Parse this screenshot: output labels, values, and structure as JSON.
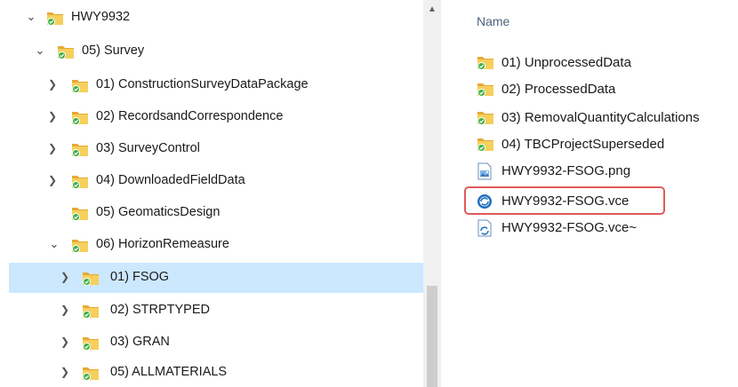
{
  "tree": {
    "items": [
      {
        "label": "HWY9932",
        "expanded": true,
        "selected": false
      },
      {
        "label": "05) Survey",
        "expanded": true,
        "selected": false
      },
      {
        "label": "01) ConstructionSurveyDataPackage",
        "expanded": false,
        "selected": false
      },
      {
        "label": "02) RecordsandCorrespondence",
        "expanded": false,
        "selected": false
      },
      {
        "label": "03) SurveyControl",
        "expanded": false,
        "selected": false
      },
      {
        "label": "04) DownloadedFieldData",
        "expanded": false,
        "selected": false
      },
      {
        "label": "05) GeomaticsDesign",
        "expanded": null,
        "selected": false
      },
      {
        "label": "06) HorizonRemeasure",
        "expanded": true,
        "selected": false
      },
      {
        "label": "01) FSOG",
        "expanded": false,
        "selected": true
      },
      {
        "label": "02) STRPTYPED",
        "expanded": false,
        "selected": false
      },
      {
        "label": "03) GRAN",
        "expanded": false,
        "selected": false
      },
      {
        "label": "05) ALLMATERIALS",
        "expanded": false,
        "selected": false
      }
    ]
  },
  "content": {
    "column_header": "Name",
    "files": [
      {
        "name": "01) UnprocessedData",
        "type": "folder"
      },
      {
        "name": "02) ProcessedData",
        "type": "folder"
      },
      {
        "name": "03) RemovalQuantityCalculations",
        "type": "folder"
      },
      {
        "name": "04) TBCProjectSuperseded",
        "type": "folder"
      },
      {
        "name": "HWY9932-FSOG.png",
        "type": "image-file"
      },
      {
        "name": "HWY9932-FSOG.vce",
        "type": "vce-file",
        "highlighted": true
      },
      {
        "name": "HWY9932-FSOG.vce~",
        "type": "vce-backup-file"
      }
    ]
  },
  "colors": {
    "selection": "#cce8ff",
    "folder": "#f2c14e",
    "sync_badge": "#3cb043",
    "highlight": "#e05a5a",
    "header_text": "#4c607a"
  },
  "icons": {
    "expanded": "chevron-down-icon",
    "collapsed": "chevron-right-icon",
    "folder": "synced-folder-icon",
    "scroll_up": "scroll-up-arrow-icon"
  }
}
